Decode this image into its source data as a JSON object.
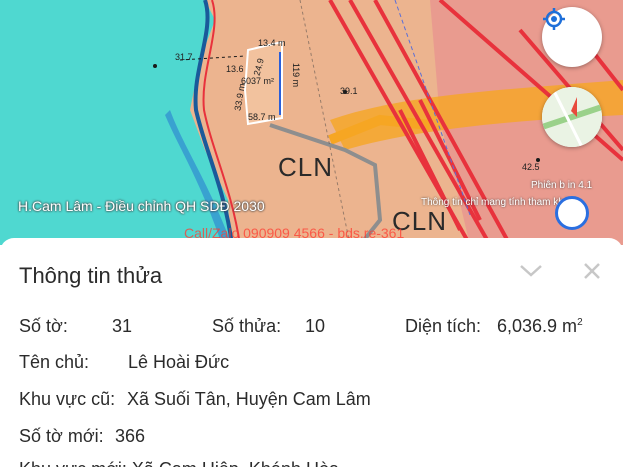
{
  "map": {
    "region_label": "H.Cam Lâm - Điều chỉnh QH SDĐ 2030",
    "watermark": "Call/Zalo 090909 4566 - bds.re-361",
    "version_label": "Phiên b in 4.1",
    "notice_label": "Thông tin chỉ mang tính tham khảo",
    "zone_labels": [
      "CLN",
      "CLN"
    ],
    "elevations": [
      "31.7",
      "39.1",
      "42.5"
    ],
    "plot": {
      "dim_top": "13.4 m",
      "dim_right": "119 m",
      "dim_bottom": "58.7 m",
      "dim_left": "13.6",
      "dim_diag": "24.9",
      "dim_left2": "33.9 m",
      "area": "6037 m²"
    },
    "colors": {
      "sea": "#4fd8d0",
      "land": "#ecb48f",
      "road": "#f6a623",
      "plan_red": "#e8323c"
    }
  },
  "parcel": {
    "title": "Thông tin thửa",
    "sheet_no_label": "Số tờ:",
    "sheet_no": "31",
    "parcel_no_label": "Số thửa:",
    "parcel_no": "10",
    "area_label": "Diện tích:",
    "area": "6,036.9 m",
    "area_unit_sup": "2",
    "owner_label": "Tên chủ:",
    "owner": "Lê Hoài Đức",
    "old_area_label": "Khu vực cũ:",
    "old_area": "Xã Suối Tân, Huyện Cam Lâm",
    "new_sheet_label": "Số tờ mới:",
    "new_sheet": "366",
    "new_area_partial": "Khu vực mới: Xã Cam Hiệp, Khánh Hòa"
  }
}
